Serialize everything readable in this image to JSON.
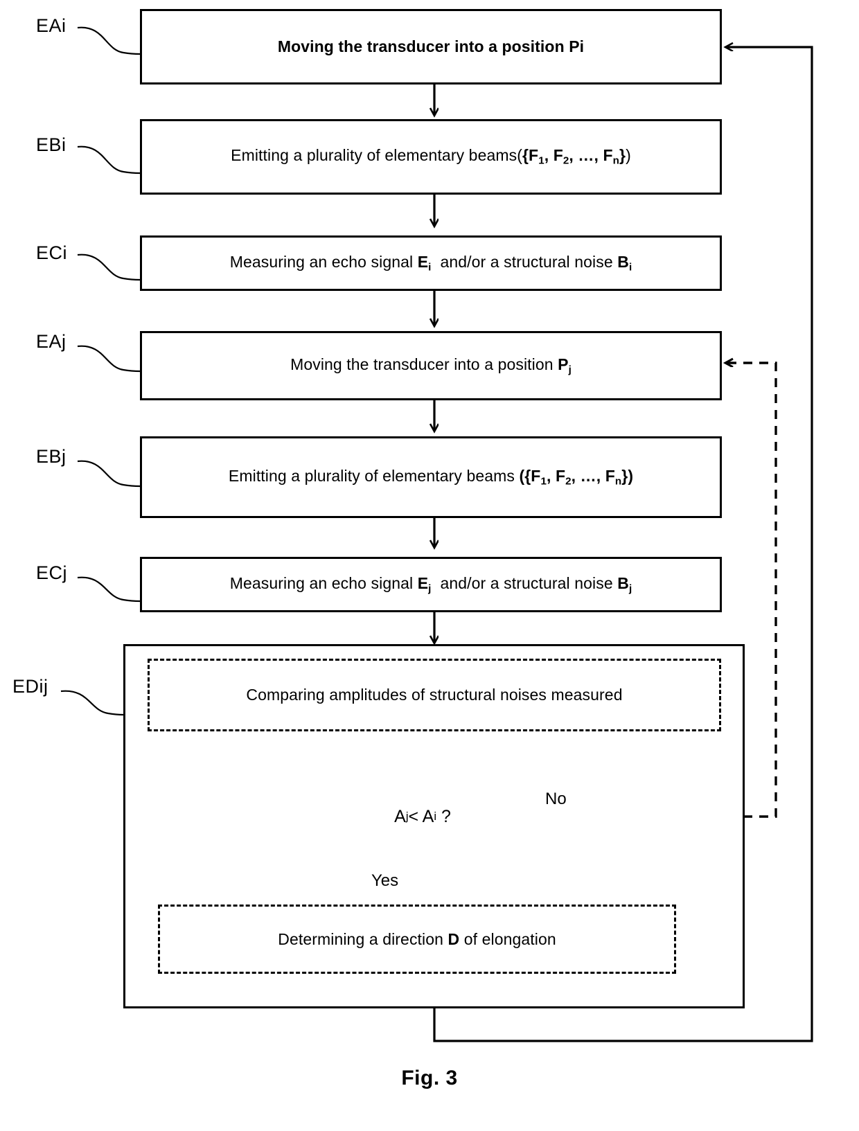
{
  "figure": {
    "caption": "Fig. 3"
  },
  "nodes": [
    {
      "id": "EAi",
      "side_label": "EAi",
      "text": "Moving the transducer into a position Pi",
      "style": "solid",
      "bold": true
    },
    {
      "id": "EBi",
      "side_label": "EBi",
      "text": "Emitting a plurality of elementary beams({F1, F2, ..., Fn})",
      "style": "solid",
      "bold": false
    },
    {
      "id": "ECi",
      "side_label": "ECi",
      "text": "Measuring an echo signal Ei  and/or a structural noise Bi",
      "style": "solid",
      "bold": false
    },
    {
      "id": "EAj",
      "side_label": "EAj",
      "text": "Moving the transducer into a position Pj",
      "style": "solid",
      "bold": false
    },
    {
      "id": "EBj",
      "side_label": "EBj",
      "text": "Emitting a plurality of elementary beams ({F1, F2, ..., Fn})",
      "style": "solid",
      "bold": false
    },
    {
      "id": "ECj",
      "side_label": "ECj",
      "text": "Measuring an echo signal Ej  and/or a structural noise Bj",
      "style": "solid",
      "bold": false
    }
  ],
  "group": {
    "side_label": "EDij",
    "compare_step": "Comparing amplitudes of structural noises measured",
    "decision": "Aj < Ai  ?",
    "determine_step": "Determining a direction D of elongation",
    "branch_yes": "Yes",
    "branch_no": "No"
  },
  "colors": {
    "stroke": "#000000",
    "background": "#ffffff"
  }
}
